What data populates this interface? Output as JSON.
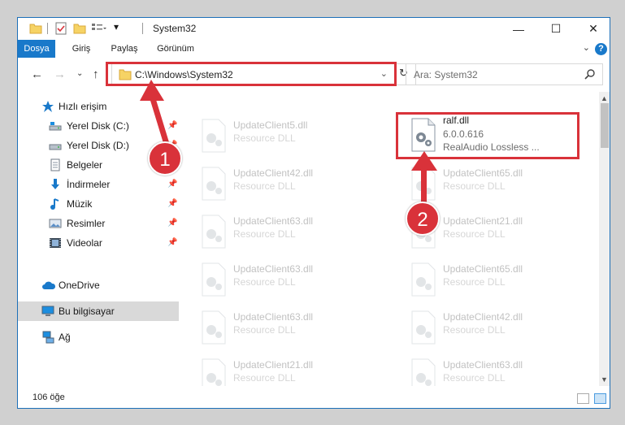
{
  "window": {
    "title": "System32",
    "controls": {
      "minimize": "—",
      "maximize": "☐",
      "close": "✕"
    }
  },
  "ribbon": {
    "tabs": [
      {
        "label": "Dosya",
        "active": true
      },
      {
        "label": "Giriş"
      },
      {
        "label": "Paylaş"
      },
      {
        "label": "Görünüm"
      }
    ],
    "help": "?"
  },
  "address": {
    "path": "C:\\Windows\\System32",
    "search_placeholder": "Ara: System32"
  },
  "nav": {
    "items": [
      {
        "label": "Hızlı erişim",
        "icon": "star-icon",
        "pinned": false
      },
      {
        "label": "Yerel Disk (C:)",
        "icon": "drive-icon",
        "pinned": true
      },
      {
        "label": "Yerel Disk (D:)",
        "icon": "drive-icon",
        "pinned": true
      },
      {
        "label": "Belgeler",
        "icon": "documents-icon",
        "pinned": true
      },
      {
        "label": "İndirmeler",
        "icon": "downloads-icon",
        "pinned": true
      },
      {
        "label": "Müzik",
        "icon": "music-icon",
        "pinned": true
      },
      {
        "label": "Resimler",
        "icon": "pictures-icon",
        "pinned": true
      },
      {
        "label": "Videolar",
        "icon": "videos-icon",
        "pinned": true
      },
      {
        "label": "OneDrive",
        "icon": "cloud-icon",
        "pinned": false
      },
      {
        "label": "Bu bilgisayar",
        "icon": "computer-icon",
        "pinned": false,
        "selected": true
      },
      {
        "label": "Ağ",
        "icon": "network-icon",
        "pinned": false
      }
    ]
  },
  "files": {
    "left_column": [
      {
        "name": "UpdateClient5.dll",
        "type": "Resource DLL"
      },
      {
        "name": "UpdateClient42.dll",
        "type": "Resource DLL"
      },
      {
        "name": "UpdateClient63.dll",
        "type": "Resource DLL"
      },
      {
        "name": "UpdateClient63.dll",
        "type": "Resource DLL"
      },
      {
        "name": "UpdateClient63.dll",
        "type": "Resource DLL"
      },
      {
        "name": "UpdateClient21.dll",
        "type": "Resource DLL"
      }
    ],
    "highlighted": {
      "name": "ralf.dll",
      "version": "6.0.0.616",
      "description": "RealAudio Lossless ..."
    },
    "right_column": [
      {
        "name": "UpdateClient65.dll",
        "type": "Resource DLL"
      },
      {
        "name": "UpdateClient21.dll",
        "type": "Resource DLL"
      },
      {
        "name": "UpdateClient65.dll",
        "type": "Resource DLL"
      },
      {
        "name": "UpdateClient42.dll",
        "type": "Resource DLL"
      },
      {
        "name": "UpdateClient63.dll",
        "type": "Resource DLL"
      }
    ]
  },
  "status": {
    "item_count": "106 öğe"
  },
  "callouts": [
    {
      "label": "1"
    },
    {
      "label": "2"
    }
  ],
  "colors": {
    "accent": "#1979ca",
    "callout": "#d9323a",
    "selected": "#d9d9d9"
  }
}
